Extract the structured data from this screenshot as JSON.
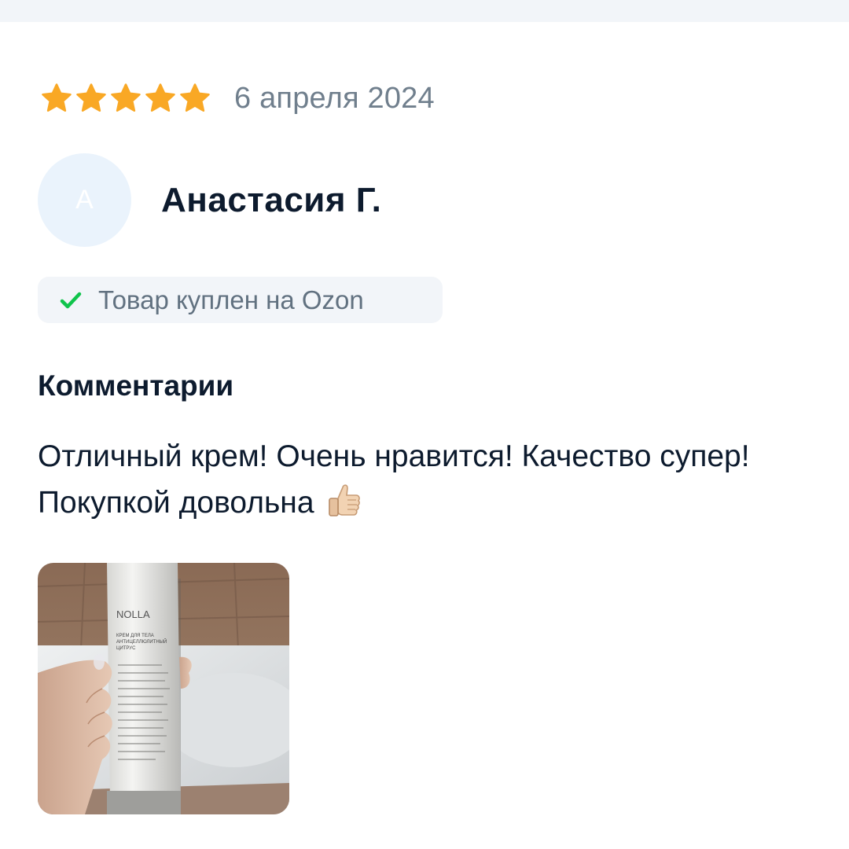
{
  "review": {
    "rating": 5,
    "rating_max": 5,
    "star_color": "#f9a825",
    "date": "6 апреля 2024",
    "author": {
      "initial": "А",
      "name": "Анастасия Г."
    },
    "verified": {
      "text": "Товар куплен на Ozon",
      "check_color": "#10c44c"
    },
    "comments_heading": "Комментарии",
    "comment": "Отличный крем! Очень нравится! Качество супер! Покупкой довольна",
    "comment_emoji": "thumbs-up-emoji",
    "photo": {
      "brand": "NOLLA",
      "label_line1": "КРЕМ ДЛЯ ТЕЛА",
      "label_line2": "АНТИЦЕЛЛЮЛИТНЫЙ",
      "label_line3": "ЦИТРУС"
    }
  }
}
